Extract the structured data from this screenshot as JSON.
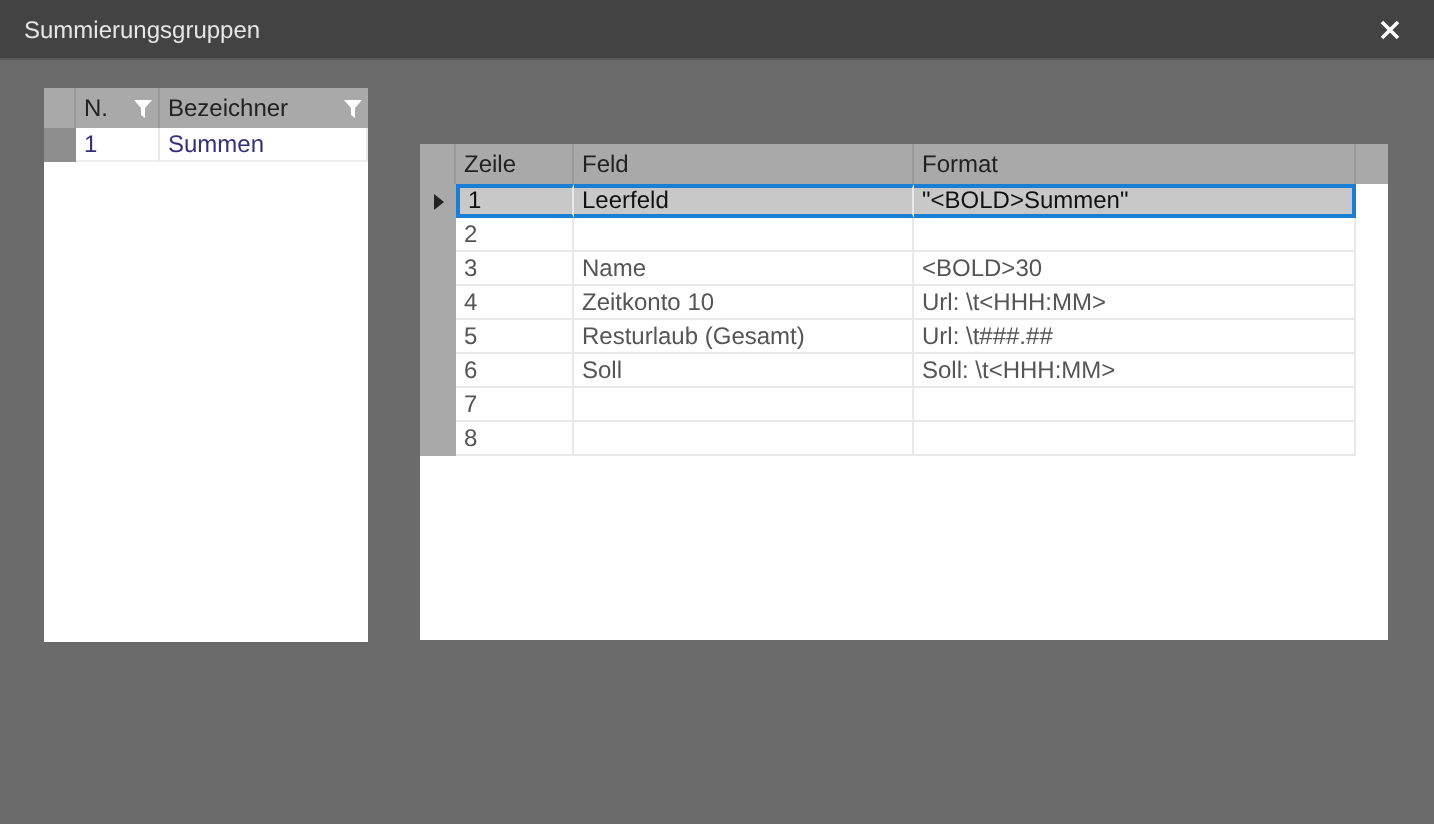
{
  "window": {
    "title": "Summierungsgruppen"
  },
  "left_grid": {
    "columns": [
      {
        "label": "N.",
        "filter": true
      },
      {
        "label": "Bezeichner",
        "filter": true
      }
    ],
    "rows": [
      {
        "n": "1",
        "bezeichner": "Summen",
        "selected": true
      }
    ]
  },
  "right_grid": {
    "columns": [
      "Zeile",
      "Feld",
      "Format"
    ],
    "rows": [
      {
        "zeile": "1",
        "feld": "Leerfeld",
        "format": "\"<BOLD>Summen\"",
        "selected": true
      },
      {
        "zeile": "2",
        "selected": false
      },
      {
        "zeile": "3",
        "feld": "Name",
        "format": "<BOLD>30",
        "selected": false
      },
      {
        "zeile": "4",
        "feld": "Zeitkonto 10",
        "format": "Url: \\t<HHH:MM>",
        "selected": false
      },
      {
        "zeile": "5",
        "feld": "Resturlaub (Gesamt)",
        "format": "Url: \\t###.##",
        "selected": false
      },
      {
        "zeile": "6",
        "feld": "Soll",
        "format": "Soll: \\t<HHH:MM>",
        "selected": false
      },
      {
        "zeile": "7",
        "selected": false
      },
      {
        "zeile": "8",
        "selected": false
      }
    ]
  }
}
